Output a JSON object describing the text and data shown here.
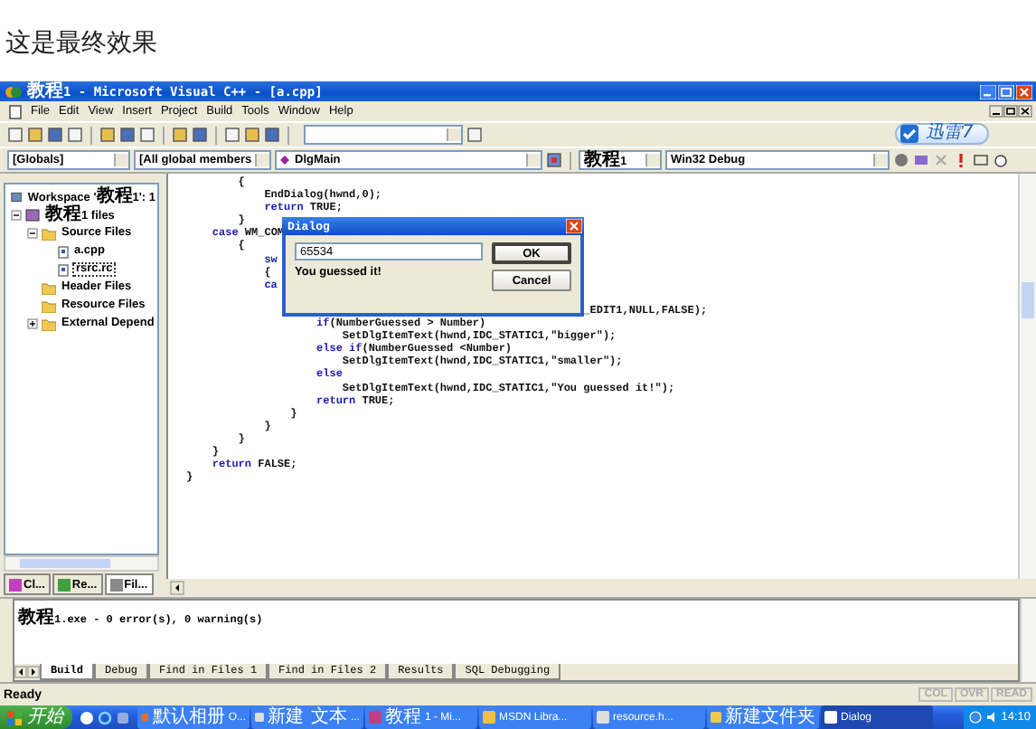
{
  "caption": "这是最终效果",
  "window": {
    "title": "教程1 - Microsoft Visual C++ - [a.cpp]"
  },
  "menu": [
    "File",
    "Edit",
    "View",
    "Insert",
    "Project",
    "Build",
    "Tools",
    "Window",
    "Help"
  ],
  "badge": "迅雷7",
  "combos": [
    {
      "value": "[Globals]"
    },
    {
      "value": "[All global members"
    },
    {
      "value": "DlgMain"
    },
    {
      "value": "教程1"
    },
    {
      "value": "Win32 Debug"
    }
  ],
  "workspace": {
    "header": "Workspace '教程1': 1",
    "tree": [
      {
        "label": "教程1 files",
        "kind": "project",
        "expanded": true,
        "selected": false,
        "children": [
          {
            "label": "Source Files",
            "kind": "folder",
            "expanded": true,
            "selected": false,
            "children": [
              {
                "label": "a.cpp",
                "kind": "file",
                "selected": false
              },
              {
                "label": "rsrc.rc",
                "kind": "file",
                "selected": true
              }
            ]
          },
          {
            "label": "Header Files",
            "kind": "folder",
            "selected": false
          },
          {
            "label": "Resource Files",
            "kind": "folder",
            "selected": false
          },
          {
            "label": "External Depend",
            "kind": "folder",
            "expanded": false,
            "selected": false
          }
        ]
      }
    ],
    "tabs": [
      {
        "label": "Cl...",
        "selected": false
      },
      {
        "label": "Re...",
        "selected": false
      },
      {
        "label": "Fil...",
        "selected": true
      }
    ]
  },
  "editor": {
    "lines": [
      {
        "segments": [
          {
            "text": "        {",
            "kind": "plain"
          }
        ]
      },
      {
        "segments": [
          {
            "text": "            EndDialog(hwnd,0);",
            "kind": "plain"
          }
        ]
      },
      {
        "segments": [
          {
            "text": "            return",
            "kind": "keyword"
          },
          {
            "text": " TRUE;",
            "kind": "plain"
          }
        ]
      },
      {
        "segments": [
          {
            "text": "        }",
            "kind": "plain"
          }
        ]
      },
      {
        "segments": [
          {
            "text": "    case",
            "kind": "keyword"
          },
          {
            "text": " WM_COM",
            "kind": "plain"
          }
        ]
      },
      {
        "segments": [
          {
            "text": "        {",
            "kind": "plain"
          }
        ]
      },
      {
        "segments": [
          {
            "text": "            sw",
            "kind": "keyword"
          }
        ]
      },
      {
        "segments": [
          {
            "text": "            {",
            "kind": "plain"
          }
        ]
      },
      {
        "segments": [
          {
            "text": "            ca",
            "kind": "keyword"
          }
        ]
      },
      {
        "gap_before": true,
        "segments": [
          {
            "text": "                                                             _EDIT1,NULL,FALSE);",
            "kind": "plain"
          }
        ]
      },
      {
        "segments": [
          {
            "text": "                    if",
            "kind": "keyword"
          },
          {
            "text": "(NumberGuessed > Number)",
            "kind": "plain"
          }
        ]
      },
      {
        "segments": [
          {
            "text": "                        SetDlgItemText(hwnd,IDC_STATIC1,\"bigger\");",
            "kind": "plain"
          }
        ]
      },
      {
        "segments": [
          {
            "text": "                    else if",
            "kind": "keyword"
          },
          {
            "text": "(NumberGuessed <Number)",
            "kind": "plain"
          }
        ]
      },
      {
        "segments": [
          {
            "text": "                        SetDlgItemText(hwnd,IDC_STATIC1,\"smaller\");",
            "kind": "plain"
          }
        ]
      },
      {
        "segments": [
          {
            "text": "                    else",
            "kind": "keyword"
          }
        ]
      },
      {
        "segments": [
          {
            "text": "                        SetDlgItemText(hwnd,IDC_STATIC1,\"You guessed it!\");",
            "kind": "plain"
          }
        ]
      },
      {
        "segments": [
          {
            "text": "                    return",
            "kind": "keyword"
          },
          {
            "text": " TRUE;",
            "kind": "plain"
          }
        ]
      },
      {
        "segments": [
          {
            "text": "                }",
            "kind": "plain"
          }
        ]
      },
      {
        "segments": [
          {
            "text": "            }",
            "kind": "plain"
          }
        ]
      },
      {
        "segments": [
          {
            "text": "        }",
            "kind": "plain"
          }
        ]
      },
      {
        "segments": [
          {
            "text": "    }",
            "kind": "plain"
          }
        ]
      },
      {
        "segments": [
          {
            "text": "    return",
            "kind": "keyword"
          },
          {
            "text": " FALSE;",
            "kind": "plain"
          }
        ]
      },
      {
        "segments": [
          {
            "text": "}",
            "kind": "plain"
          }
        ]
      }
    ]
  },
  "dialog": {
    "title": "Dialog",
    "value": "65534",
    "message": "You guessed it!",
    "buttons": [
      {
        "label": "OK",
        "default": true
      },
      {
        "label": "Cancel",
        "default": false
      }
    ]
  },
  "output": {
    "text": "教程1.exe - 0 error(s), 0 warning(s)",
    "tabs": [
      {
        "label": "Build",
        "selected": true
      },
      {
        "label": "Debug",
        "selected": false
      },
      {
        "label": "Find in Files 1",
        "selected": false
      },
      {
        "label": "Find in Files 2",
        "selected": false
      },
      {
        "label": "Results",
        "selected": false
      },
      {
        "label": "SQL Debugging",
        "selected": false
      }
    ]
  },
  "status_bar": {
    "text": "Ready",
    "indicators": [
      "COL",
      "OVR",
      "READ"
    ]
  },
  "taskbar": {
    "start": "开始",
    "items": [
      {
        "label": "默认相册 O...",
        "selected": false
      },
      {
        "label": "新建 文本...",
        "selected": false
      },
      {
        "label": "教程1 - Mi...",
        "selected": false
      },
      {
        "label": "MSDN Libra...",
        "selected": false
      },
      {
        "label": "resource.h...",
        "selected": false
      },
      {
        "label": "新建文件夹",
        "selected": false
      },
      {
        "label": "Dialog",
        "selected": true
      }
    ],
    "clock": "14:10"
  }
}
